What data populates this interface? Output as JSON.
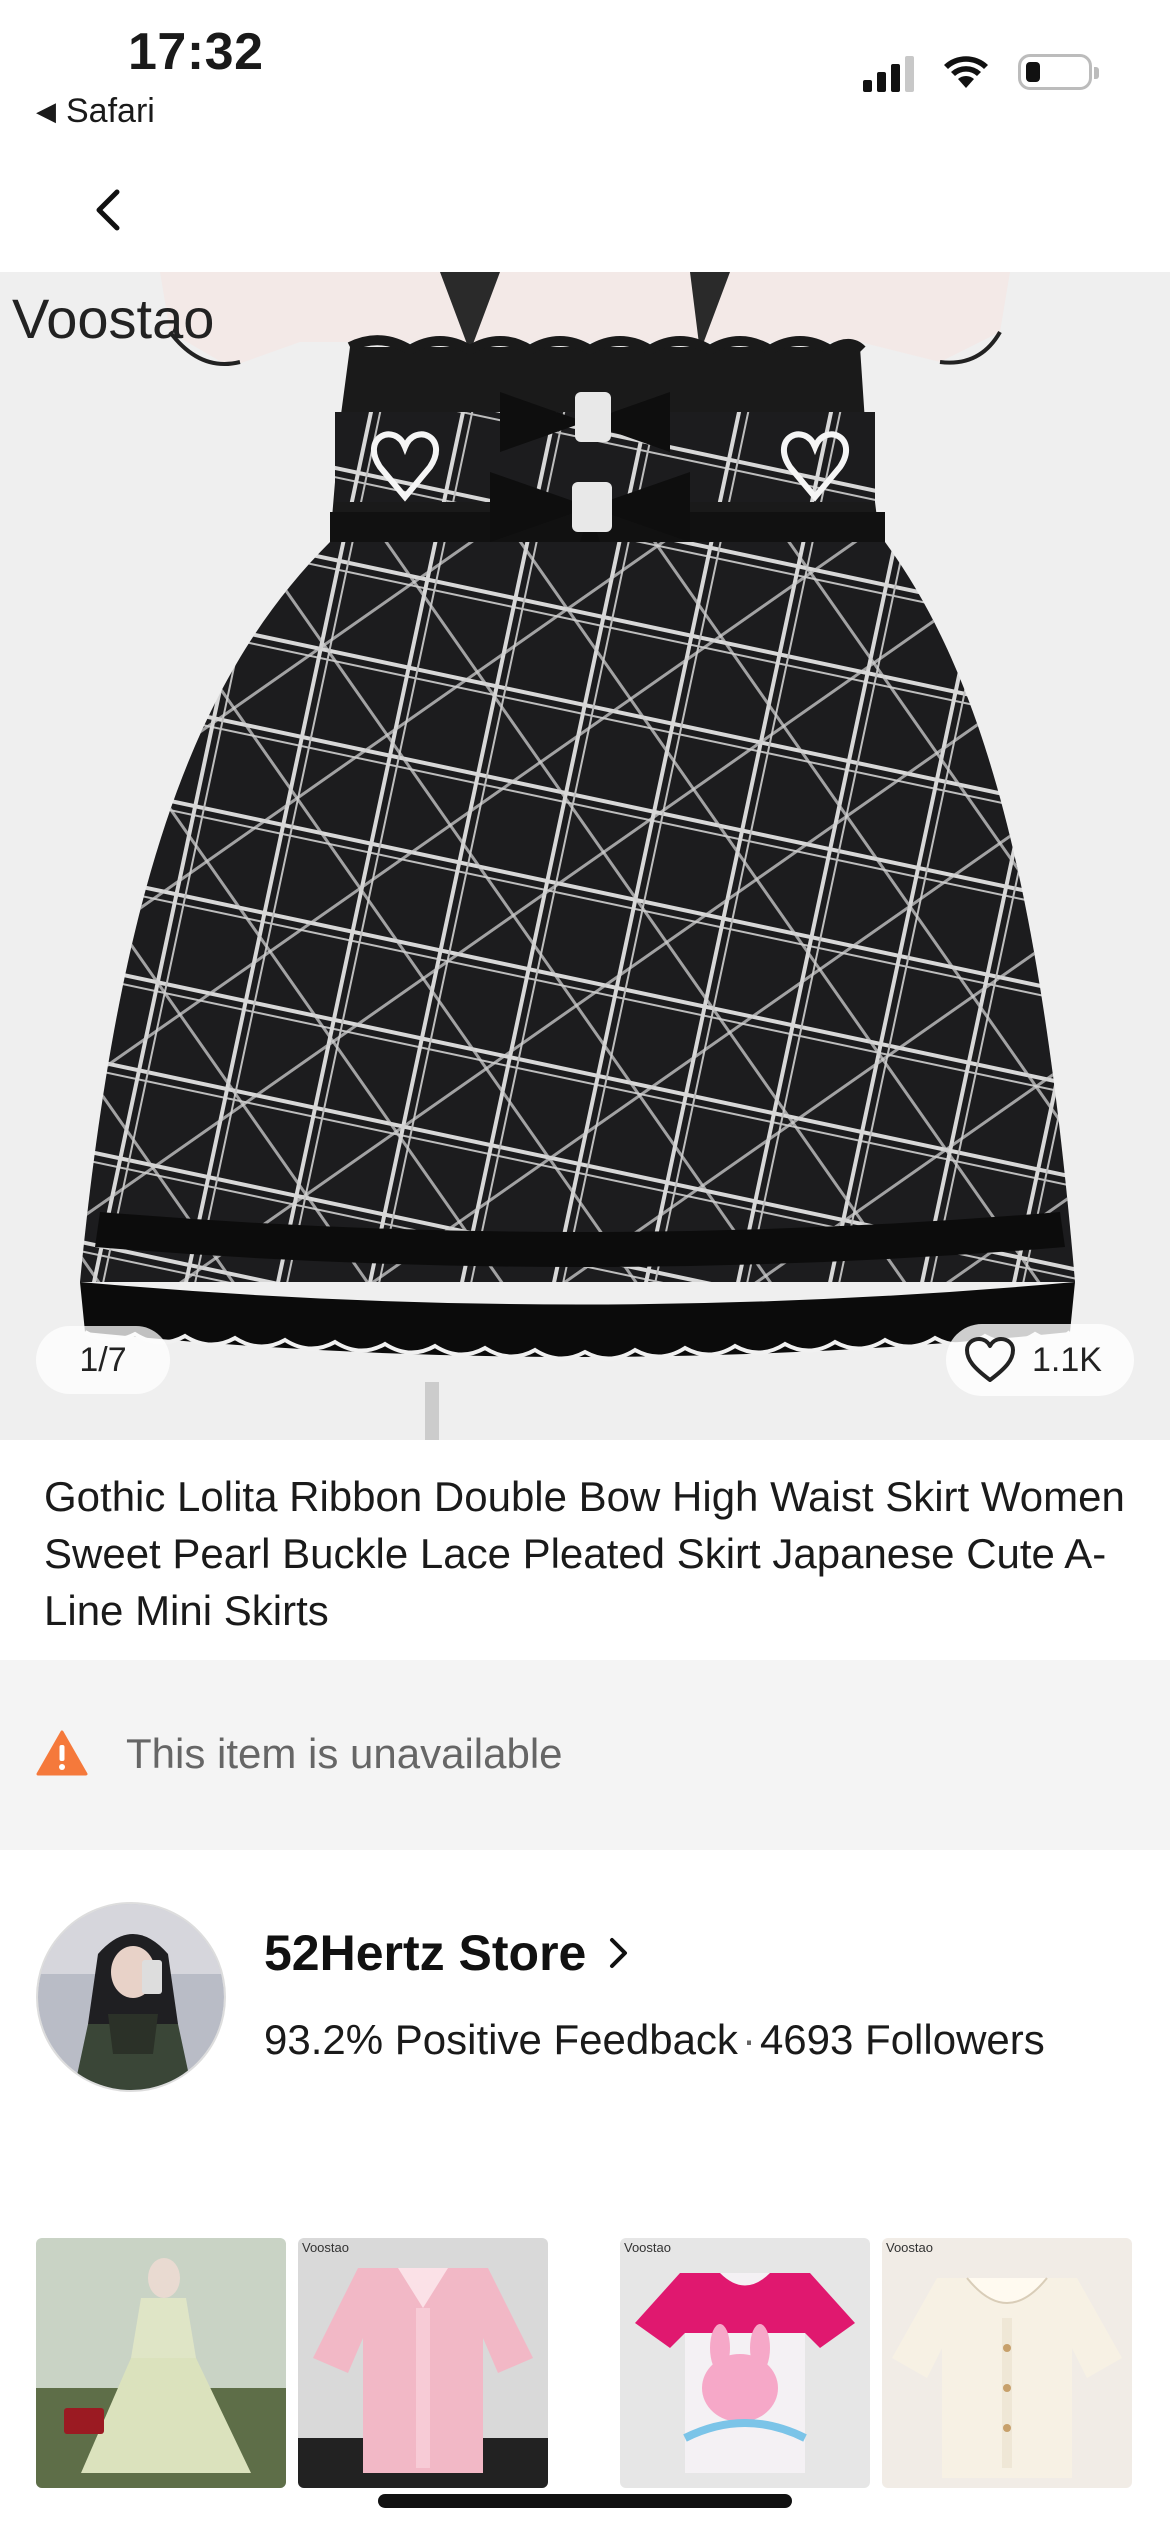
{
  "status_bar": {
    "time": "17:32",
    "back_app": "Safari"
  },
  "product": {
    "watermark": "Voostao",
    "image_counter": "1/7",
    "likes": "1.1K",
    "title": "Gothic Lolita Ribbon Double Bow High Waist Skirt Women Sweet Pearl Buckle Lace Pleated Skirt Japanese Cute A-Line Mini Skirts"
  },
  "availability": {
    "message": "This item is unavailable",
    "icon": "warning-icon",
    "icon_color": "#f5793b"
  },
  "store": {
    "name": "52Hertz Store",
    "feedback": "93.2% Positive Feedback",
    "separator": "·",
    "followers": "4693 Followers"
  },
  "thumbnails": {
    "watermark": "Voostao",
    "items": [
      "green-dress-thumbnail",
      "pink-blouse-thumbnail",
      "bunny-tshirt-thumbnail",
      "cream-blouse-thumbnail"
    ]
  }
}
